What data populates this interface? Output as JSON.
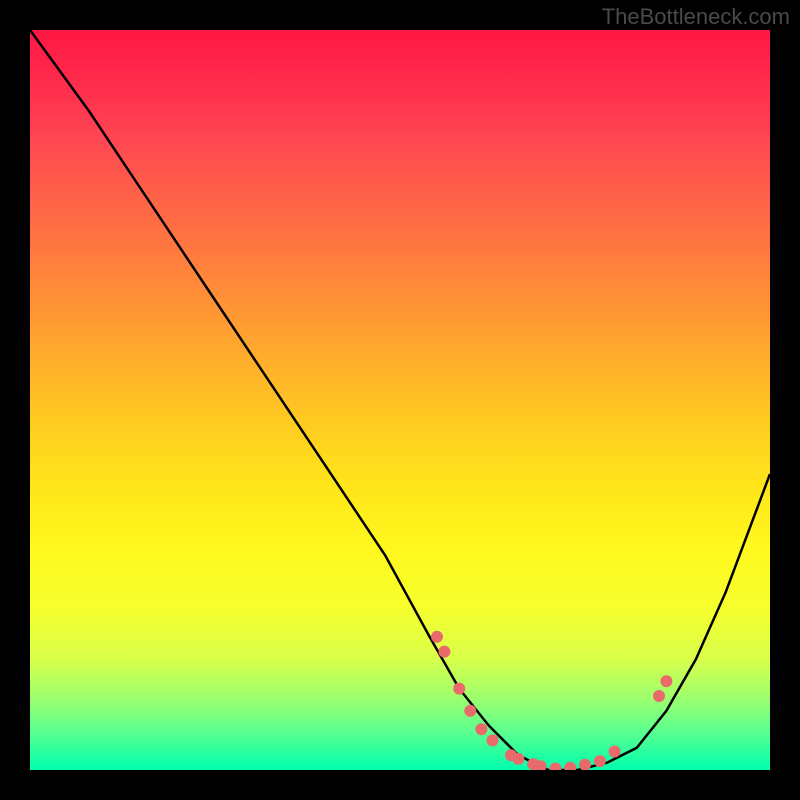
{
  "attribution": "TheBottleneck.com",
  "chart_data": {
    "type": "line",
    "title": "",
    "xlabel": "",
    "ylabel": "",
    "xlim": [
      0,
      100
    ],
    "ylim": [
      0,
      100
    ],
    "series": [
      {
        "name": "bottleneck-curve",
        "x": [
          0,
          8,
          16,
          24,
          32,
          40,
          48,
          54,
          58,
          62,
          66,
          70,
          74,
          78,
          82,
          86,
          90,
          94,
          100
        ],
        "values": [
          100,
          89,
          77,
          65,
          53,
          41,
          29,
          18,
          11,
          6,
          2,
          0,
          0,
          1,
          3,
          8,
          15,
          24,
          40
        ]
      }
    ],
    "markers": {
      "name": "highlighted-points",
      "points": [
        {
          "x": 55,
          "y": 18
        },
        {
          "x": 56,
          "y": 16
        },
        {
          "x": 58,
          "y": 11
        },
        {
          "x": 59.5,
          "y": 8
        },
        {
          "x": 61,
          "y": 5.5
        },
        {
          "x": 62.5,
          "y": 4
        },
        {
          "x": 65,
          "y": 2
        },
        {
          "x": 66,
          "y": 1.5
        },
        {
          "x": 68,
          "y": 0.8
        },
        {
          "x": 69,
          "y": 0.5
        },
        {
          "x": 71,
          "y": 0.2
        },
        {
          "x": 73,
          "y": 0.3
        },
        {
          "x": 75,
          "y": 0.7
        },
        {
          "x": 77,
          "y": 1.2
        },
        {
          "x": 79,
          "y": 2.5
        },
        {
          "x": 85,
          "y": 10
        },
        {
          "x": 86,
          "y": 12
        }
      ]
    },
    "gradient_stops": [
      {
        "pos": 0,
        "color": "#ff1744"
      },
      {
        "pos": 50,
        "color": "#ffce20"
      },
      {
        "pos": 100,
        "color": "#00ffae"
      }
    ]
  }
}
